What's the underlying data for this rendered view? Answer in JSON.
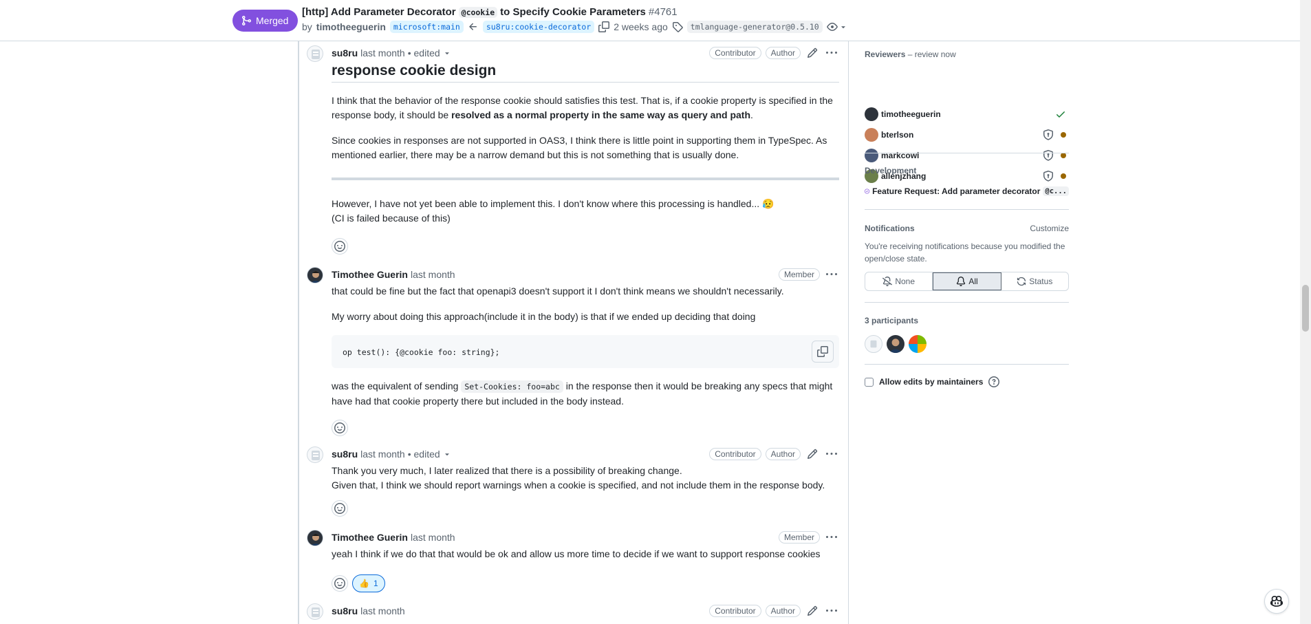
{
  "header": {
    "status": "Merged",
    "title_prefix": "[http] Add Parameter Decorator",
    "title_code": "@cookie",
    "title_suffix": "to Specify Cookie Parameters",
    "number": "#4761",
    "by": "by",
    "author": "timotheeguerin",
    "base_branch": "microsoft:main",
    "head_branch": "su8ru:cookie-decorator",
    "time": "2 weeks ago",
    "tag": "tmlanguage-generator@0.5.10"
  },
  "comments": [
    {
      "author": "su8ru",
      "time": "last month",
      "edited": "• edited",
      "labels": [
        "Contributor",
        "Author"
      ],
      "heading": "response cookie design",
      "p1_start": "I think that the behavior of the response cookie should satisfies this test. That is, if a cookie property is specified in the response body, it should be ",
      "p1_bold": "resolved as a normal property in the same way as query and path",
      "p1_end": ".",
      "p2": "Since cookies in responses are not supported in OAS3, I think there is little point in supporting them in TypeSpec. As mentioned earlier, there may be a narrow demand but this is not something that is usually done.",
      "p3_line1": "However, I have not yet been able to implement this. I don't know where this processing is handled... 😥",
      "p3_line2": "(CI is failed because of this)"
    },
    {
      "author": "Timothee Guerin",
      "time": "last month",
      "labels": [
        "Member"
      ],
      "p1": "that could be fine but the fact that openapi3 doesn't support it I don't think means we shouldn't necessarily.",
      "p2": "My worry about doing this approach(include it in the body) is that if we ended up deciding that doing",
      "code": "op test(): {@cookie foo: string};",
      "p3_start": "was the equivalent of sending ",
      "p3_code": "Set-Cookies: foo=abc",
      "p3_end": " in the response then it would be breaking any specs that might have had that cookie property there but included in the body instead."
    },
    {
      "author": "su8ru",
      "time": "last month",
      "edited": "• edited",
      "labels": [
        "Contributor",
        "Author"
      ],
      "line1": "Thank you very much, I later realized that there is a possibility of breaking change.",
      "line2": "Given that, I think we should report warnings when a cookie is specified, and not include them in the response body."
    },
    {
      "author": "Timothee Guerin",
      "time": "last month",
      "labels": [
        "Member"
      ],
      "text": "yeah I think if we do that that would be ok and allow us more time to decide if we want to support response cookies",
      "reaction_emoji": "👍",
      "reaction_count": "1"
    },
    {
      "author": "su8ru",
      "time": "last month",
      "labels": [
        "Contributor",
        "Author"
      ]
    }
  ],
  "sidebar": {
    "reviewers_title": "Reviewers",
    "reviewers_sub": "– review now",
    "reviewers": [
      {
        "name": "timotheeguerin",
        "status": "approved"
      },
      {
        "name": "bterlson",
        "status": "pending"
      },
      {
        "name": "markcowl",
        "status": "pending"
      },
      {
        "name": "allenjzhang",
        "status": "pending"
      }
    ],
    "development_title": "Development",
    "linked_issue_text": "Feature Request: Add parameter decorator",
    "linked_issue_code": "@c...",
    "notifications_title": "Notifications",
    "customize": "Customize",
    "notif_reason": "You're receiving notifications because you modified the open/close state.",
    "notif_options": [
      "None",
      "All",
      "Status"
    ],
    "participants": "3 participants",
    "allow_edits": "Allow edits by maintainers"
  },
  "colors": {
    "merged": "#8250df",
    "link": "#0969da",
    "pending_dot": "#9a6700",
    "approved": "#1a7f37"
  }
}
